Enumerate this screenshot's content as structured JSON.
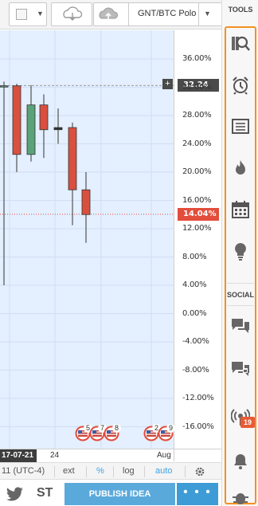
{
  "toolbar": {
    "symbol": "GNT/BTC Polo"
  },
  "chart_data": {
    "type": "candlestick",
    "ylim": [
      -18.0,
      39.0
    ],
    "y_ticks": [
      "36.00%",
      "32.00%",
      "28.00%",
      "24.00%",
      "20.00%",
      "16.00%",
      "12.00%",
      "8.00%",
      "4.00%",
      "0.00%",
      "-4.00%",
      "-8.00%",
      "-12.00%",
      "-16.00%"
    ],
    "crosshair_value": "32.24",
    "current_value": "14.04%",
    "candles": [
      {
        "open": 32.2,
        "high": 32.8,
        "low": 4.0,
        "close": 32.2,
        "color": "green"
      },
      {
        "open": 32.2,
        "high": 32.5,
        "low": 20.0,
        "close": 22.5,
        "color": "red"
      },
      {
        "open": 22.5,
        "high": 32.3,
        "low": 21.5,
        "close": 29.5,
        "color": "green"
      },
      {
        "open": 29.5,
        "high": 31.0,
        "low": 22.0,
        "close": 26.0,
        "color": "red"
      },
      {
        "open": 26.0,
        "high": 29.0,
        "low": 24.0,
        "close": 26.3,
        "color": "doji"
      },
      {
        "open": 26.3,
        "high": 27.0,
        "low": 12.5,
        "close": 17.5,
        "color": "red"
      },
      {
        "open": 17.5,
        "high": 20.0,
        "low": 10.0,
        "close": 14.0,
        "color": "red"
      }
    ],
    "x_ticks": [
      "24",
      "Aug"
    ],
    "x_current_label": "17-07-21"
  },
  "events": [
    "5",
    "7",
    "8",
    "2",
    "9"
  ],
  "controls": {
    "timezone": "11 (UTC-4)",
    "ext": "ext",
    "percent": "%",
    "log": "log",
    "auto": "auto"
  },
  "footer": {
    "st": "ST",
    "publish": "PUBLISH IDEA",
    "more": "• • •"
  },
  "tools_panel": {
    "title": "TOOLS",
    "social_title": "SOCIAL",
    "streams_badge": "19",
    "tool_icons": [
      "screener-icon",
      "alarm-clock-icon",
      "watchlist-icon",
      "hotlist-flame-icon",
      "calendar-icon",
      "ideas-bulb-icon"
    ],
    "social_icons": [
      "chat-icon",
      "private-chat-icon",
      "streams-icon",
      "notifications-bell-icon",
      "bug-icon"
    ]
  },
  "colors": {
    "accent_orange": "#f39123",
    "candle_up": "#5aa277",
    "candle_down": "#d9503f",
    "publish_blue": "#5aa9db"
  }
}
